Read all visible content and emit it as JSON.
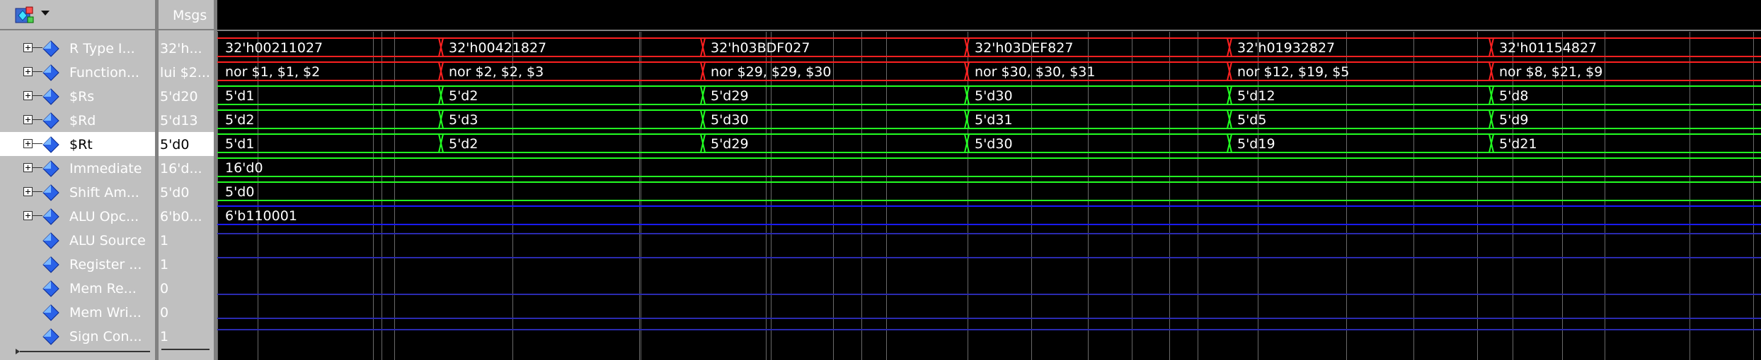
{
  "header": {
    "msgs_label": "Msgs",
    "menu_icon": "toolbar-wave-icon"
  },
  "colors": {
    "bus_red": "#ff2020",
    "bus_green": "#22ff22",
    "bus_blue": "#1a1aff",
    "bit_blue": "#2a2ab0",
    "grid": "#6a6a6a"
  },
  "signals": [
    {
      "name": "R Type I...",
      "value": "32'h...",
      "expandable": true,
      "selected": false,
      "color": "red",
      "segments": [
        "32'h00211027",
        "32'h00421827",
        "32'h03BDF027",
        "32'h03DEF827",
        "32'h01932827",
        "32'h01154827"
      ]
    },
    {
      "name": "Function...",
      "value": "lui $2...",
      "expandable": true,
      "selected": false,
      "color": "red",
      "segments": [
        "nor $1, $1, $2",
        "nor $2, $2, $3",
        "nor $29, $29, $30",
        "nor $30, $30, $31",
        "nor $12, $19, $5",
        "nor $8, $21, $9"
      ]
    },
    {
      "name": "$Rs",
      "value": "5'd20",
      "expandable": true,
      "selected": false,
      "color": "green",
      "segments": [
        "5'd1",
        "5'd2",
        "5'd29",
        "5'd30",
        "5'd12",
        "5'd8"
      ]
    },
    {
      "name": "$Rd",
      "value": "5'd13",
      "expandable": true,
      "selected": false,
      "color": "green",
      "segments": [
        "5'd2",
        "5'd3",
        "5'd30",
        "5'd31",
        "5'd5",
        "5'd9"
      ]
    },
    {
      "name": "$Rt",
      "value": "5'd0",
      "expandable": true,
      "selected": true,
      "color": "green",
      "segments": [
        "5'd1",
        "5'd2",
        "5'd29",
        "5'd30",
        "5'd19",
        "5'd21"
      ]
    },
    {
      "name": "Immediate",
      "value": "16'd...",
      "expandable": true,
      "selected": false,
      "color": "green",
      "segments": [
        "16'd0"
      ]
    },
    {
      "name": "Shift Am...",
      "value": "5'd0",
      "expandable": true,
      "selected": false,
      "color": "green",
      "segments": [
        "5'd0"
      ]
    },
    {
      "name": "ALU Opc...",
      "value": "6'b0...",
      "expandable": true,
      "selected": false,
      "color": "blue",
      "segments": [
        "6'b110001"
      ]
    },
    {
      "name": "ALU Source",
      "value": "1",
      "expandable": false,
      "selected": false,
      "color": "bit",
      "segments": []
    },
    {
      "name": "Register ...",
      "value": "1",
      "expandable": false,
      "selected": false,
      "color": "bit",
      "segments": []
    },
    {
      "name": "Mem Re...",
      "value": "0",
      "expandable": false,
      "selected": false,
      "color": "bit",
      "segments": []
    },
    {
      "name": "Mem Wri...",
      "value": "0",
      "expandable": false,
      "selected": false,
      "color": "bit",
      "segments": []
    },
    {
      "name": "Sign Con...",
      "value": "1",
      "expandable": false,
      "selected": false,
      "color": "bit",
      "segments": []
    }
  ]
}
